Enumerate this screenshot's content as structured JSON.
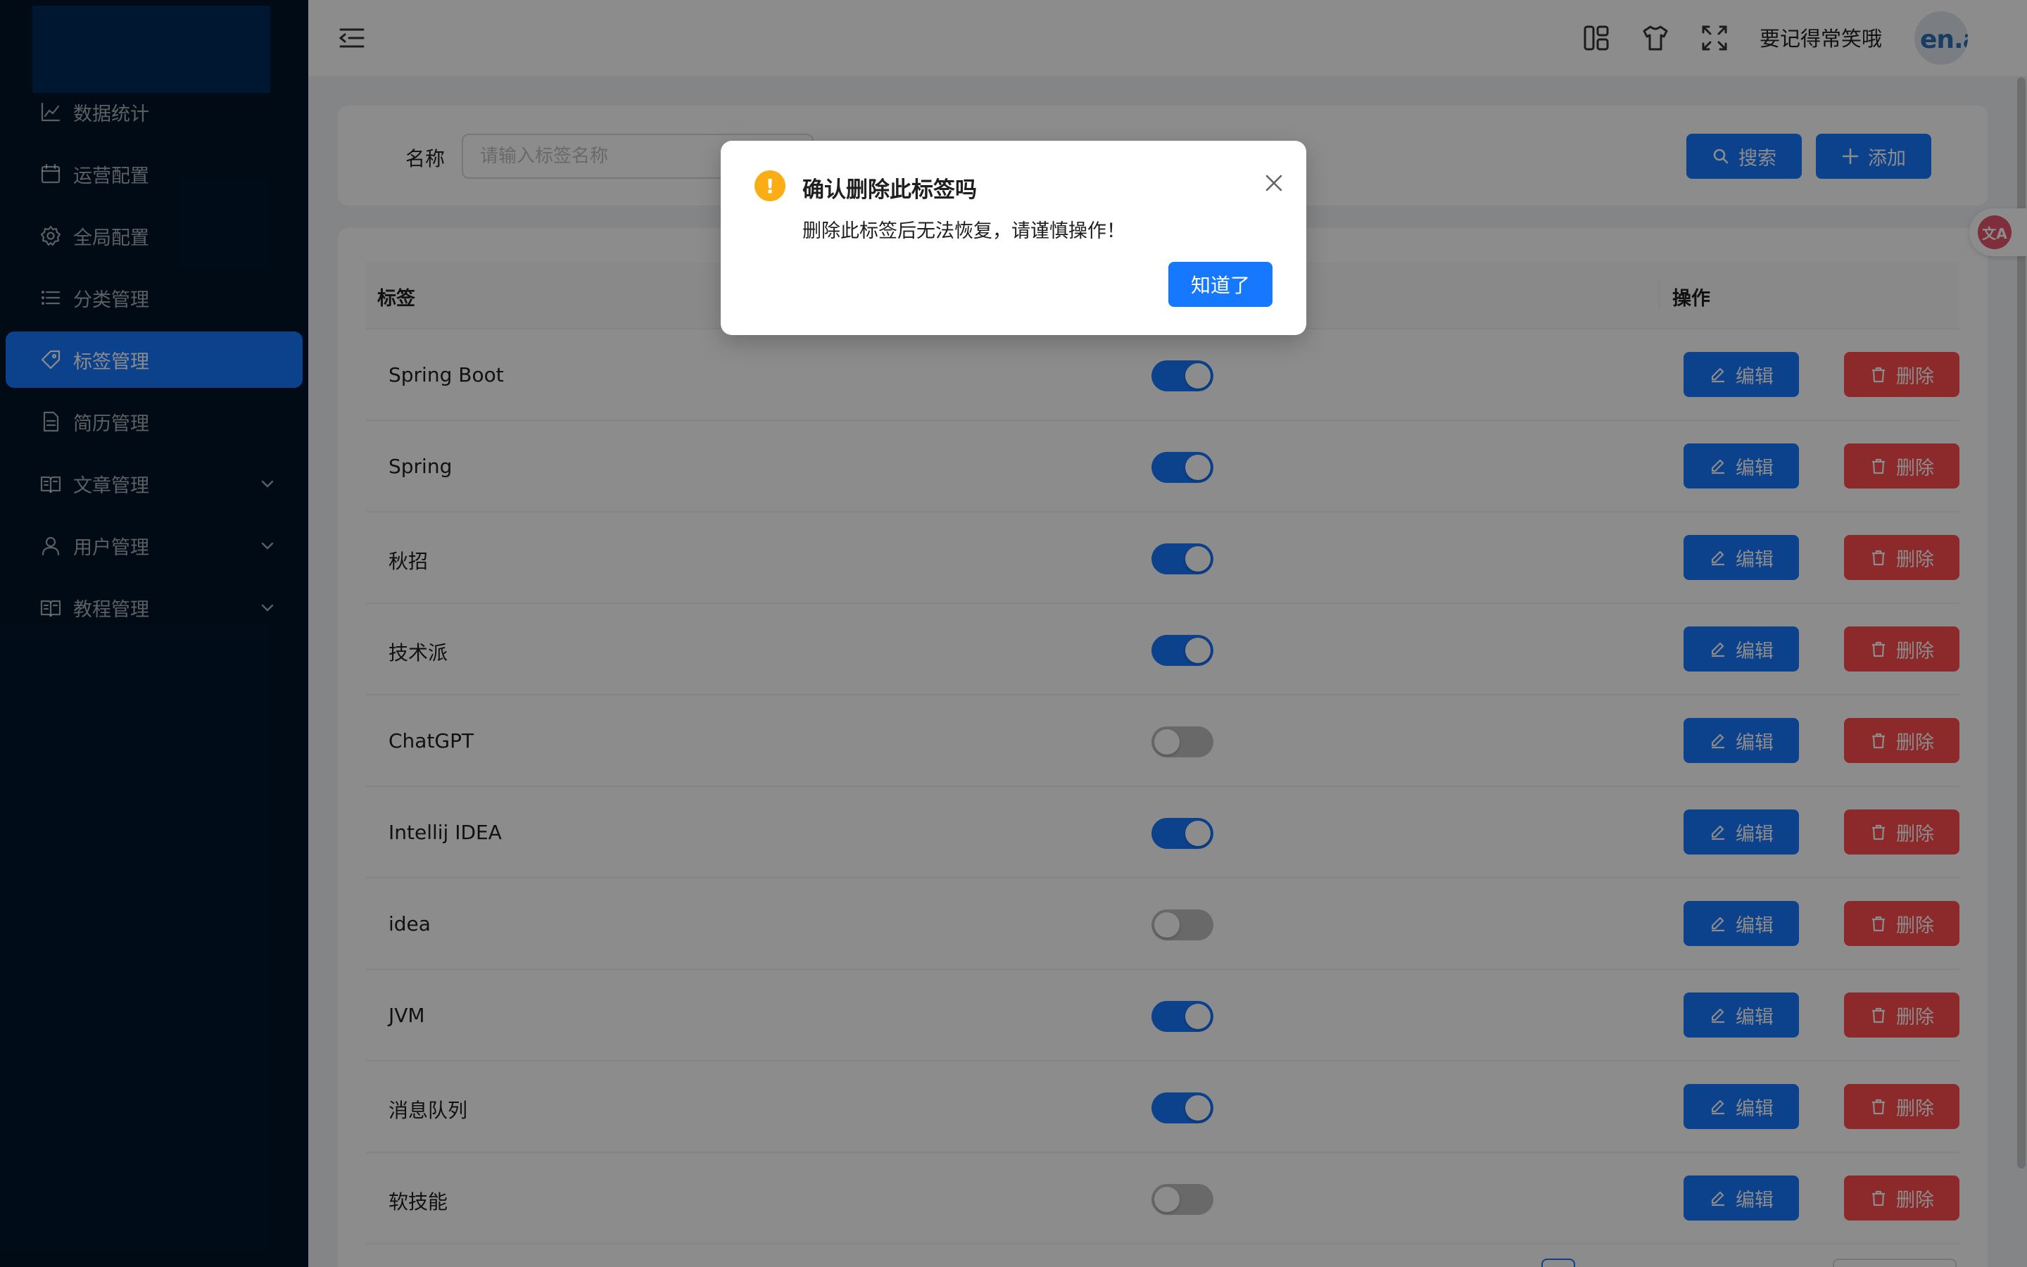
{
  "sidebar": {
    "items": [
      {
        "label": "数据统计",
        "icon": "line-chart-icon",
        "active": false,
        "has_children": false
      },
      {
        "label": "运营配置",
        "icon": "calendar-icon",
        "active": false,
        "has_children": false
      },
      {
        "label": "全局配置",
        "icon": "gear-icon",
        "active": false,
        "has_children": false
      },
      {
        "label": "分类管理",
        "icon": "list-icon",
        "active": false,
        "has_children": false
      },
      {
        "label": "标签管理",
        "icon": "tag-icon",
        "active": true,
        "has_children": false
      },
      {
        "label": "简历管理",
        "icon": "file-icon",
        "active": false,
        "has_children": false
      },
      {
        "label": "文章管理",
        "icon": "book-icon",
        "active": false,
        "has_children": true
      },
      {
        "label": "用户管理",
        "icon": "user-icon",
        "active": false,
        "has_children": true
      },
      {
        "label": "教程管理",
        "icon": "book-icon",
        "active": false,
        "has_children": true
      }
    ]
  },
  "header": {
    "icons": [
      "layout-icon",
      "tshirt-icon",
      "fullscreen-icon"
    ],
    "username": "要记得常笑哦",
    "avatar_text": "en.a"
  },
  "search": {
    "label": "名称",
    "placeholder": "请输入标签名称",
    "search_button": "搜索",
    "add_button": "添加"
  },
  "table": {
    "columns": {
      "tag": "标签",
      "actions": "操作"
    },
    "edit_label": "编辑",
    "delete_label": "删除",
    "rows": [
      {
        "name": "Spring Boot",
        "enabled": true
      },
      {
        "name": "Spring",
        "enabled": true
      },
      {
        "name": "秋招",
        "enabled": true
      },
      {
        "name": "技术派",
        "enabled": true
      },
      {
        "name": "ChatGPT",
        "enabled": false
      },
      {
        "name": "Intellij IDEA",
        "enabled": true
      },
      {
        "name": "idea",
        "enabled": false
      },
      {
        "name": "JVM",
        "enabled": true
      },
      {
        "name": "消息队列",
        "enabled": true
      },
      {
        "name": "软技能",
        "enabled": false
      }
    ]
  },
  "modal": {
    "icon": "exclamation-icon",
    "warn_glyph": "!",
    "title": "确认删除此标签吗",
    "content": "删除此标签后无法恢复，请谨慎操作！",
    "ok_label": "知道了"
  },
  "translate_float": {
    "label": "文A"
  },
  "colors": {
    "primary": "#1677ff",
    "danger": "#ff4d4f",
    "warning": "#faad14",
    "sidebar_bg": "#001529"
  }
}
